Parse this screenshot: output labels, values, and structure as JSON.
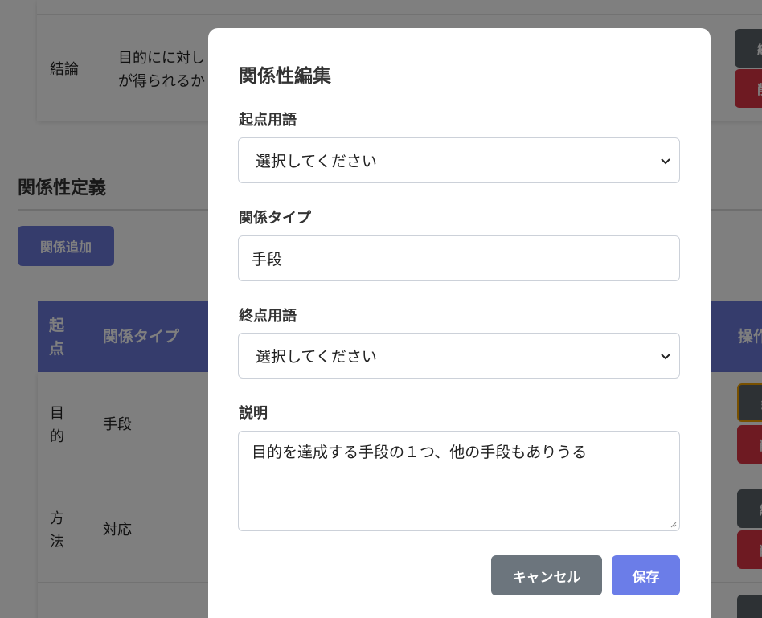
{
  "background": {
    "top_table": {
      "row_label": "結論",
      "row_text_line1": "目的にに対し",
      "row_text_line2": "が得られるか"
    },
    "section_title": "関係性定義",
    "add_button_label": "関係追加",
    "relations_table": {
      "headers": {
        "start": "起点",
        "type": "関係タイプ",
        "actions": "操作"
      },
      "rows": [
        {
          "start": "目的",
          "type": "手段"
        },
        {
          "start": "方法",
          "type": "対応"
        }
      ],
      "button_edit_fragment": "編",
      "button_delete_fragment": "削"
    }
  },
  "modal": {
    "title": "関係性編集",
    "start_term_label": "起点用語",
    "start_term_value": "選択してください",
    "relation_type_label": "関係タイプ",
    "relation_type_value": "手段",
    "end_term_label": "終点用語",
    "end_term_value": "選択してください",
    "description_label": "説明",
    "description_value": "目的を達成する手段の１つ、他の手段もありうる",
    "cancel_label": "キャンセル",
    "save_label": "保存"
  },
  "colors": {
    "primary": "#6b78d9",
    "save": "#6b7de8",
    "cancel": "#6c757d",
    "danger": "#dc3545"
  }
}
